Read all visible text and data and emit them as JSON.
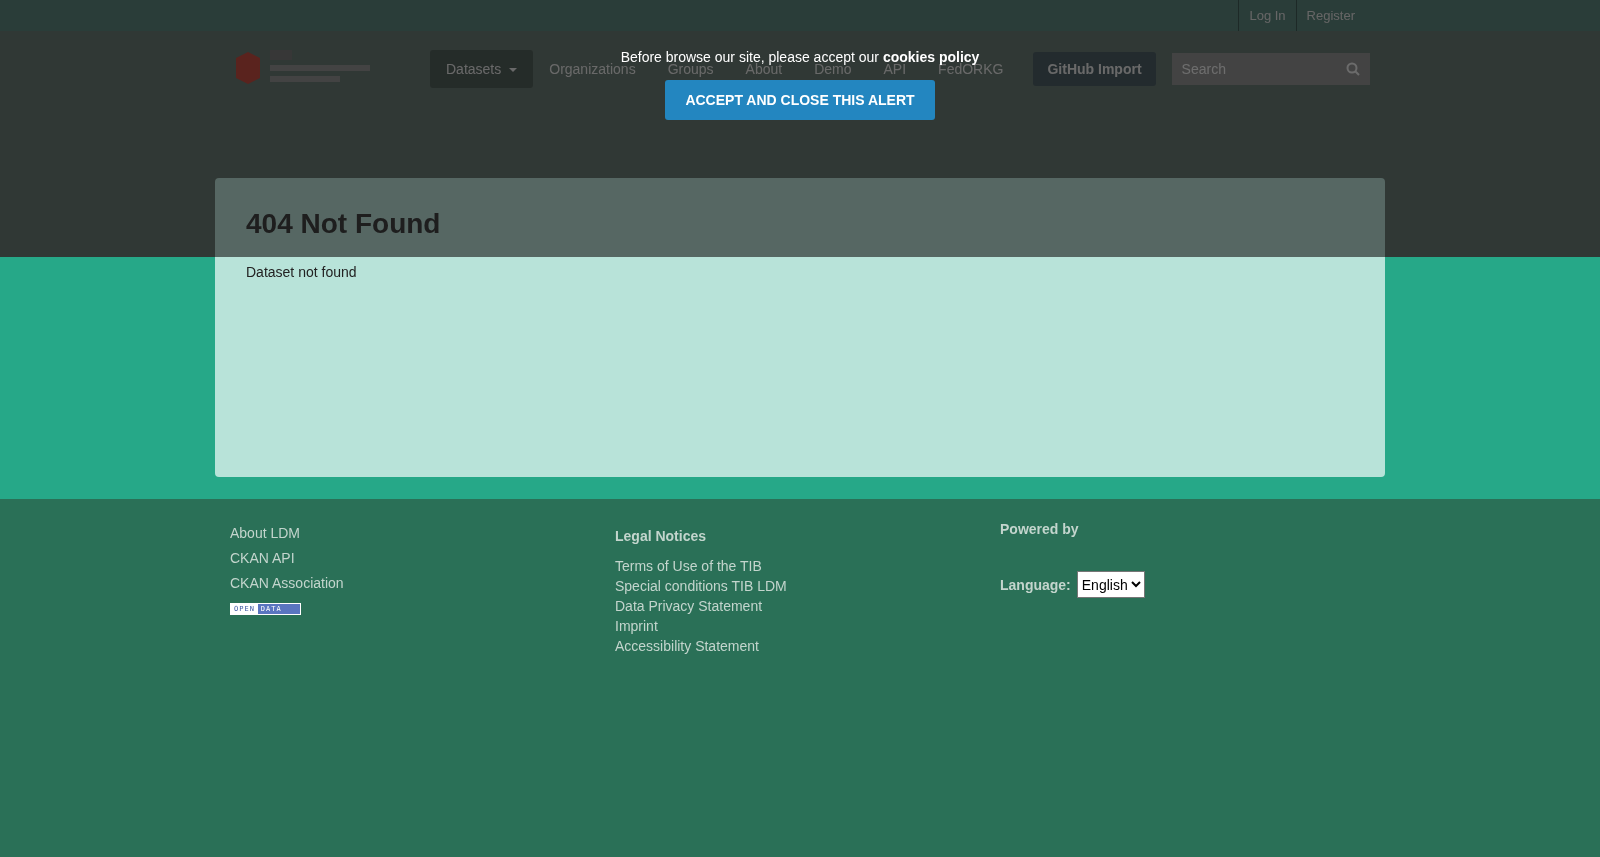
{
  "top_bar": {
    "links": [
      "Log In",
      "Register"
    ]
  },
  "nav": {
    "items": [
      {
        "label": "Datasets",
        "selected": true,
        "dropdown": true
      },
      {
        "label": "Organizations",
        "selected": false,
        "dropdown": false
      },
      {
        "label": "Groups",
        "selected": false,
        "dropdown": false
      },
      {
        "label": "About",
        "selected": false,
        "dropdown": false
      },
      {
        "label": "Demo",
        "selected": false,
        "dropdown": false
      },
      {
        "label": "API",
        "selected": false,
        "dropdown": false
      },
      {
        "label": "FedORKG",
        "selected": false,
        "dropdown": false
      }
    ],
    "github_button": "GitHub Import",
    "search": {
      "placeholder": "Search"
    }
  },
  "cookie_alert": {
    "text": "Before browse our site, please accept our **cookies policy**",
    "button": "ACCEPT AND CLOSE THIS ALERT"
  },
  "main": {
    "title": "404 Not Found",
    "message": "Dataset not found"
  },
  "footer": {
    "links": [
      "About LDM",
      "CKAN API",
      "CKAN Association"
    ],
    "open_data_badge": [
      "OPEN",
      "DATA"
    ],
    "legal": {
      "heading": "Legal Notices",
      "links": [
        "Terms of Use of the TIB",
        "Special conditions TIB LDM",
        "Data Privacy Statement",
        "Imprint",
        "Accessibility Statement"
      ]
    },
    "powered_by": "Powered by",
    "language": {
      "label": "Language:",
      "value": "English"
    }
  }
}
